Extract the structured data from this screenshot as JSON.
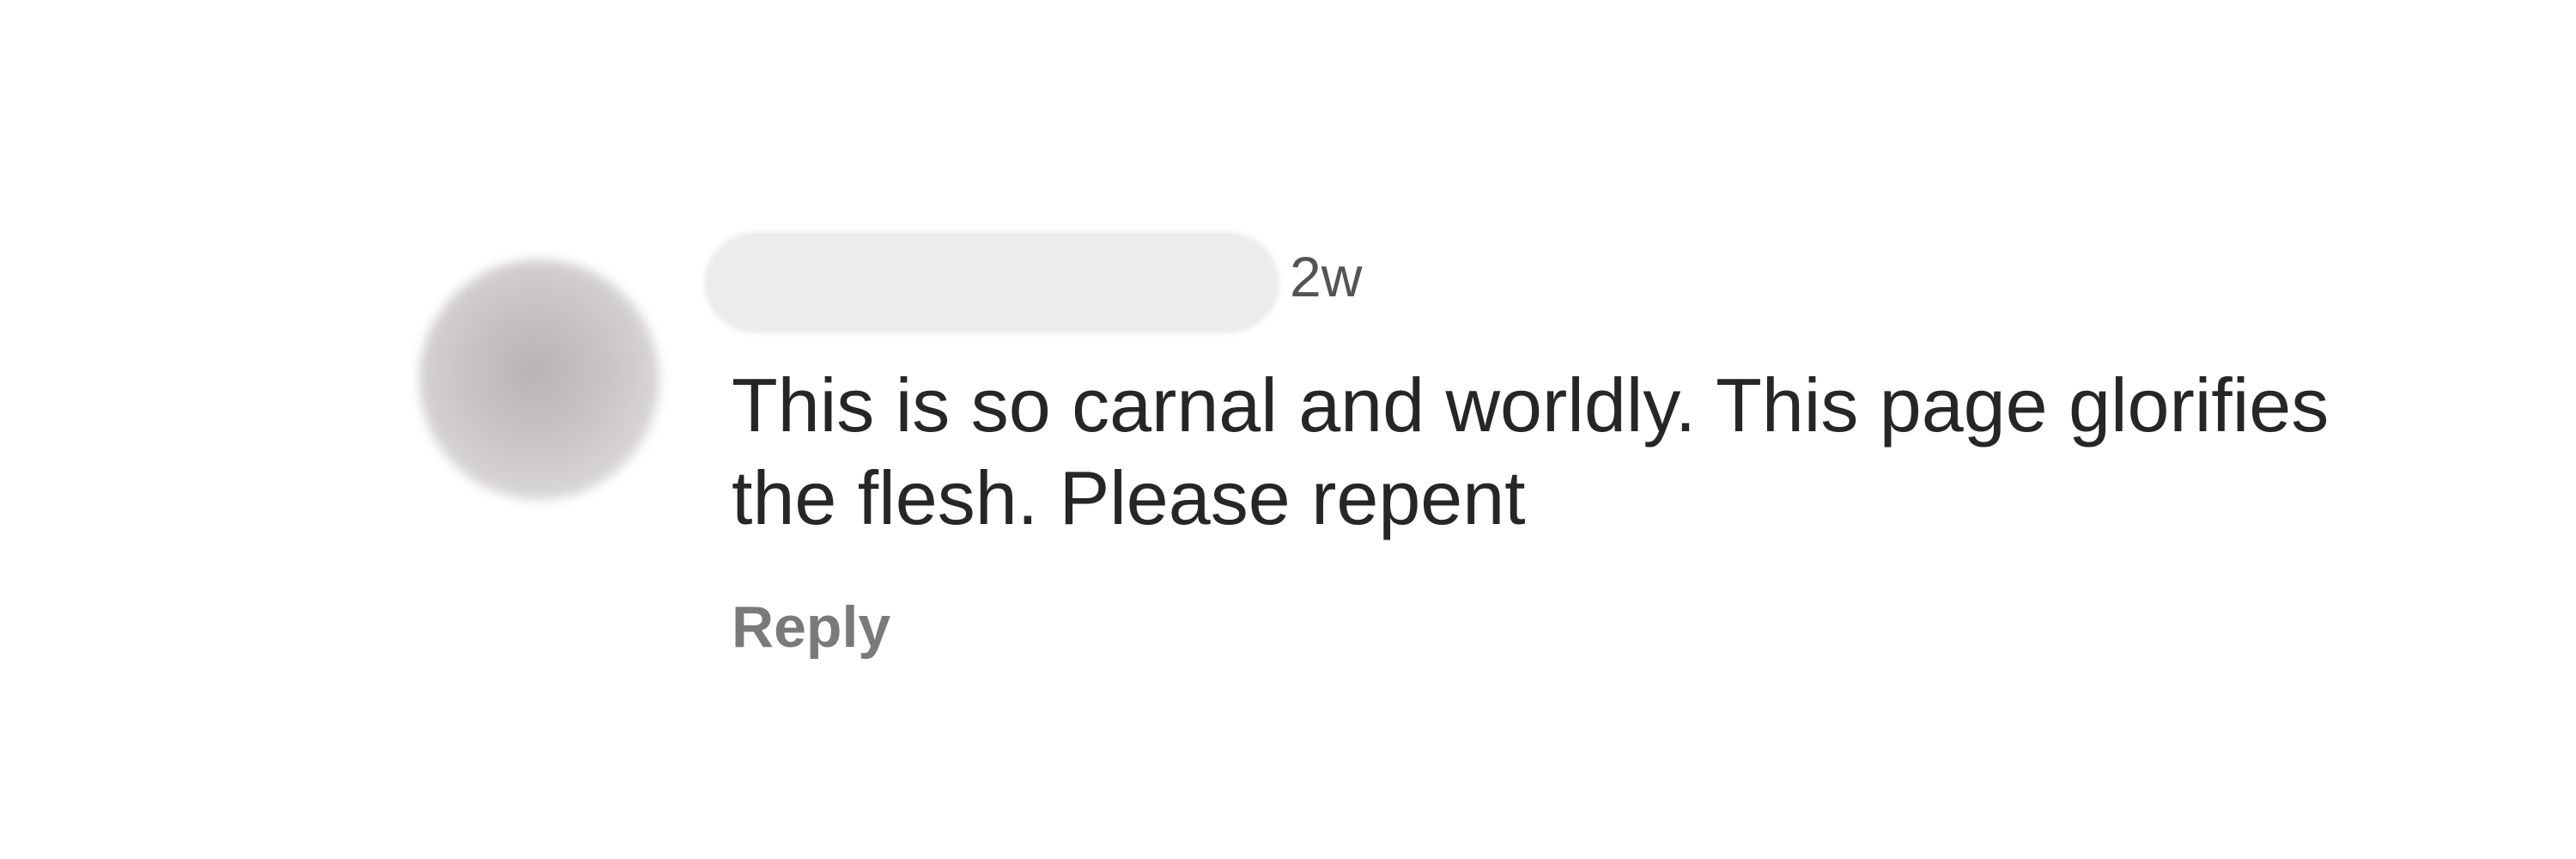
{
  "comment": {
    "timestamp": "2w",
    "text": "This is so carnal and worldly. This page glorifies the flesh. Please repent",
    "reply_label": "Reply"
  },
  "colors": {
    "background": "#ffffff",
    "text": "#262626",
    "timestamp": "#545454",
    "reply": "#7a7a7a",
    "redaction": "#ececec",
    "avatar": "#c9c4c6"
  }
}
